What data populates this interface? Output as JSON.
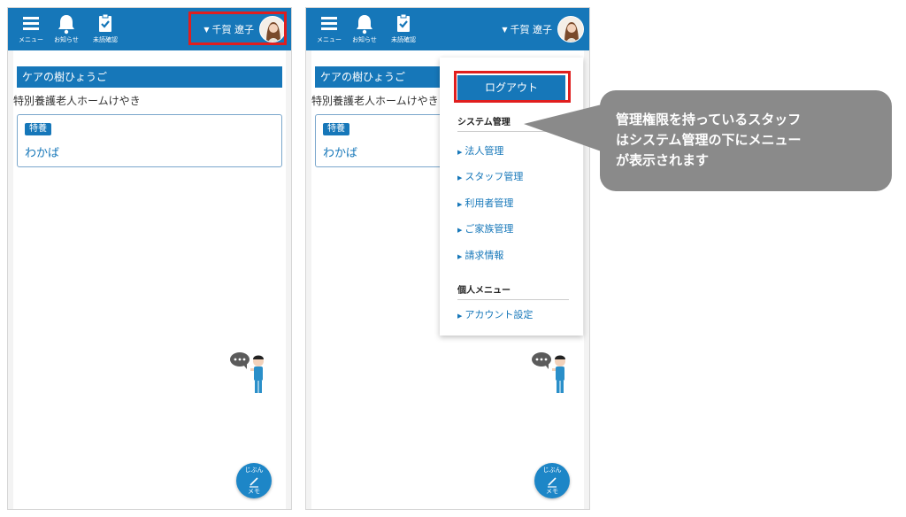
{
  "left_screen": {
    "header": {
      "menu_label": "メニュー",
      "notice_label": "お知らせ",
      "unread_label": "未読確認",
      "user_name": "千賀 遼子"
    },
    "facility": "ケアの樹ひょうご",
    "subfacility": "特別養護老人ホームけやき",
    "unit_tag": "特養",
    "unit_name": "わかば",
    "memo_button": {
      "line1": "じぶん",
      "line2": "メモ"
    }
  },
  "right_screen": {
    "header": {
      "menu_label": "メニュー",
      "notice_label": "お知らせ",
      "unread_label": "未読確認",
      "user_name": "千賀 遼子"
    },
    "facility": "ケアの樹ひょうご",
    "subfacility": "特別養護老人ホームけやき",
    "unit_tag": "特養",
    "unit_name": "わかば",
    "memo_button": {
      "line1": "じぶん",
      "line2": "メモ"
    },
    "dropdown": {
      "logout_label": "ログアウト",
      "system_section": "システム管理",
      "system_items": [
        "法人管理",
        "スタッフ管理",
        "利用者管理",
        "ご家族管理",
        "請求情報"
      ],
      "personal_section": "個人メニュー",
      "personal_items": [
        "アカウント設定"
      ]
    }
  },
  "callout": {
    "lines": [
      "管理権限を持っているスタッフ",
      "はシステム管理の下にメニュー",
      "が表示されます"
    ]
  },
  "icons": {
    "menu": "hamburger-icon",
    "notice": "bell-icon",
    "unread": "clipboard-check-icon",
    "user_caret": "caret-down-icon",
    "menu_item_bullet": "triangle-right-icon",
    "memo": "pencil-icon"
  },
  "colors": {
    "header_blue": "#1677b9",
    "highlight_red": "#e01e1e",
    "callout_gray": "#8a8a8a",
    "memo_button": "#1d86c7"
  }
}
